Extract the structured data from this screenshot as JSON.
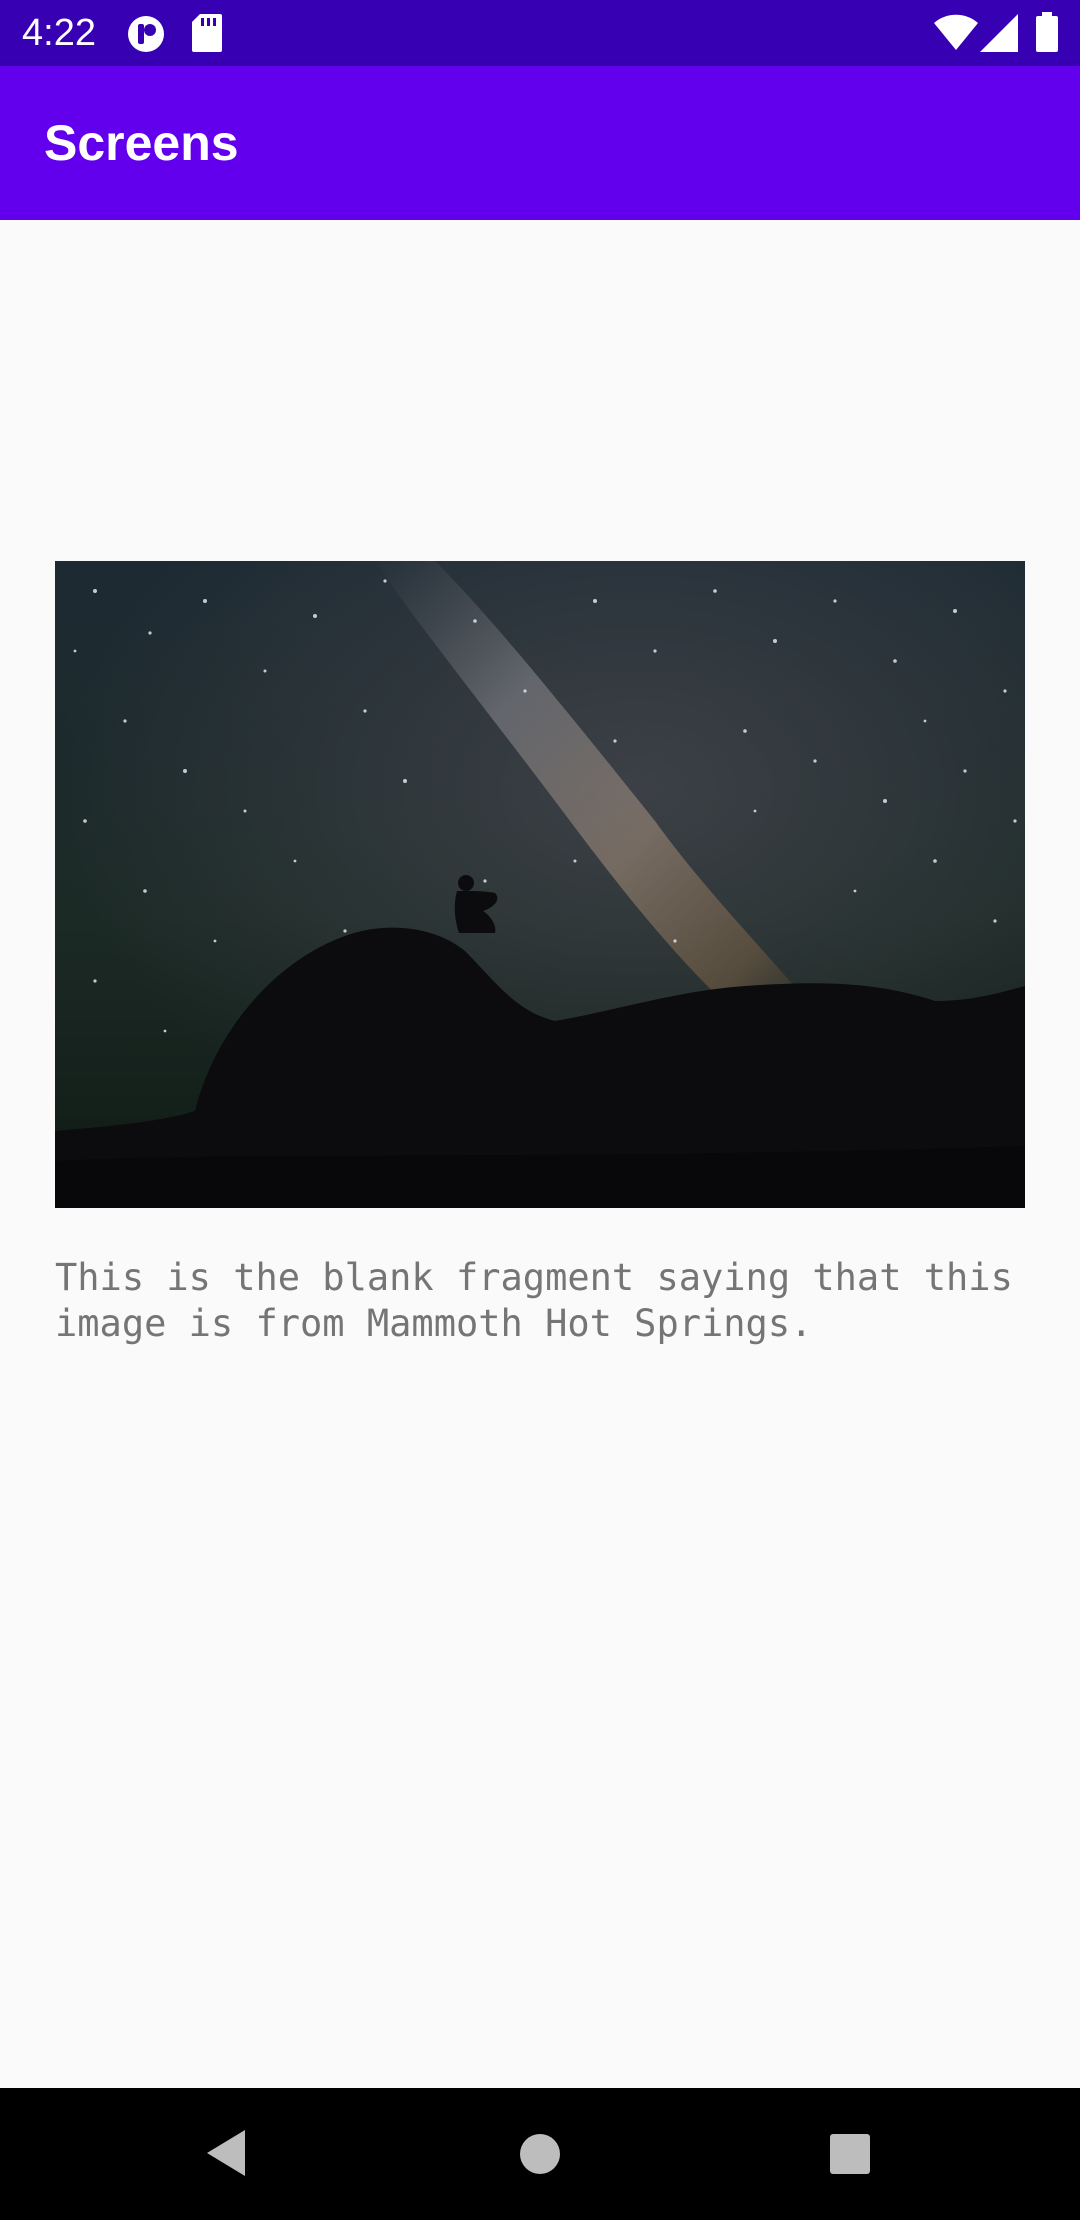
{
  "status_bar": {
    "time": "4:22",
    "icons": [
      "notification-app-icon",
      "sd-card-icon",
      "wifi-icon",
      "cellular-signal-icon",
      "battery-icon"
    ],
    "background": "#3700b3"
  },
  "app_bar": {
    "title": "Screens",
    "background": "#6200ee"
  },
  "main": {
    "image_description_icon": "milky-way-night-photo",
    "caption": "This is the blank fragment saying that this image is from Mammoth Hot Springs."
  },
  "nav_bar": {
    "icons": [
      "back-icon",
      "home-icon",
      "recents-icon"
    ]
  }
}
